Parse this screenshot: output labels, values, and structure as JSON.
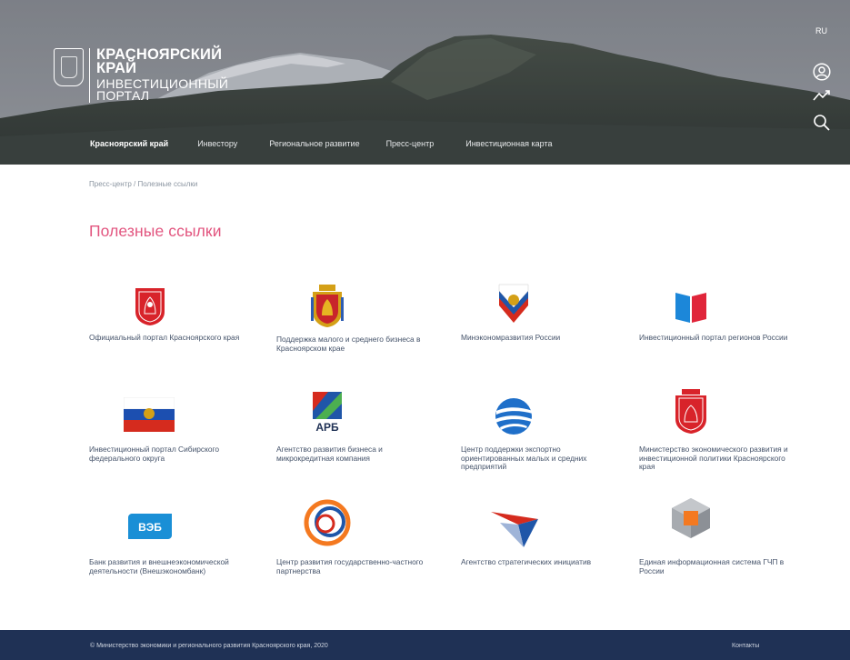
{
  "header": {
    "logo_line1": "КРАСНОЯРСКИЙ",
    "logo_line2": "КРАЙ",
    "logo_line3": "ИНВЕСТИЦИОННЫЙ",
    "logo_line4": "ПОРТАЛ",
    "lang": "RU",
    "icons": [
      "user-icon",
      "trend-icon",
      "search-icon"
    ]
  },
  "nav": {
    "items": [
      {
        "label": "Красноярский край"
      },
      {
        "label": "Инвестору"
      },
      {
        "label": "Региональное развитие"
      },
      {
        "label": "Пресс-центр"
      },
      {
        "label": "Инвестиционная карта"
      }
    ]
  },
  "breadcrumb": {
    "parent": "Пресс-центр",
    "separator": "/",
    "current": "Полезные ссылки"
  },
  "page": {
    "title": "Полезные ссылки"
  },
  "links": [
    {
      "label": "Официальный портал Красноярского края"
    },
    {
      "label": "Поддержка малого и среднего бизнеса в Красноярском крае"
    },
    {
      "label": "Минэкономразвития России"
    },
    {
      "label": "Инвестиционный портал регионов России"
    },
    {
      "label": "Инвестиционный портал Сибирского федерального округа"
    },
    {
      "label": "Агентство развития бизнеса и микрокредитная компания"
    },
    {
      "label": "Центр поддержки экспортно ориентированных малых и средних предприятий"
    },
    {
      "label": "Министерство экономического развития и инвестиционной политики Красноярского края"
    },
    {
      "label": "Банк развития и внешнеэкономической деятельности (Внешэкономбанк)"
    },
    {
      "label": "Центр развития государственно-частного партнерства"
    },
    {
      "label": "Агентство стратегических инициатив"
    },
    {
      "label": "Единая информационная система ГЧП в России"
    }
  ],
  "logos": {
    "arb_text": "АРБ",
    "veb_text": "ВЭБ"
  },
  "footer": {
    "copyright": "© Министерство экономики и регионального развития Красноярского края, 2020",
    "contacts": "Контакты"
  },
  "colors": {
    "title_accent": "#e2557f",
    "footer_bg": "#1f3155",
    "link_text": "#45536a"
  }
}
